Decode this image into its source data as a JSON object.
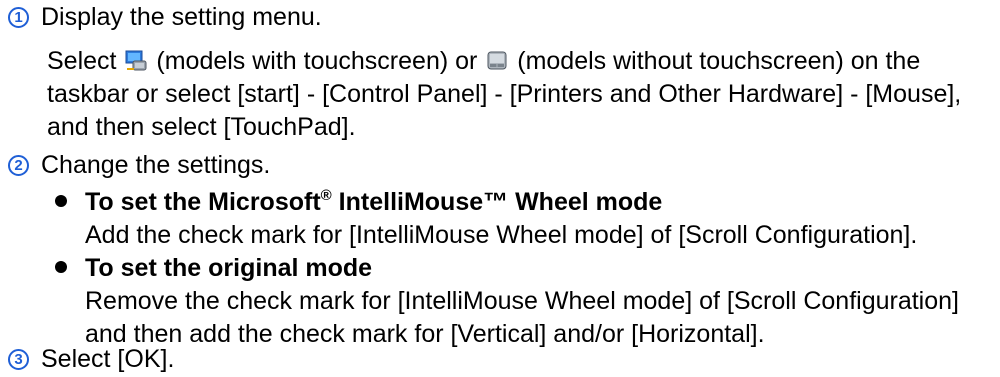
{
  "steps": [
    {
      "number": "1",
      "title": "Display the setting menu."
    },
    {
      "number": "2",
      "title": "Change the settings."
    },
    {
      "number": "3",
      "title": "Select [OK]."
    }
  ],
  "step1_body": {
    "pre": "Select",
    "touch_icon": "touchscreen-taskbar-icon",
    "mid": " (models with touchscreen) or ",
    "notouch_icon": "touchpad-taskbar-icon",
    "post": " (models without touchscreen) on the taskbar or select [start] - [Control Panel] - [Printers and Other Hardware] - [Mouse], and then select [TouchPad]."
  },
  "bullets": [
    {
      "heading_pre": "To set the Microsoft",
      "heading_sup": "®",
      "heading_post": " IntelliMouse™ Wheel mode",
      "body": "Add the check mark for [IntelliMouse Wheel mode] of [Scroll Configuration]."
    },
    {
      "heading": "To set the original mode",
      "body": "Remove the check mark for [IntelliMouse Wheel mode] of [Scroll Configuration] and then add the check mark for [Vertical] and/or [Horizontal]."
    }
  ],
  "colors": {
    "step_number": "#1f5fd6"
  }
}
